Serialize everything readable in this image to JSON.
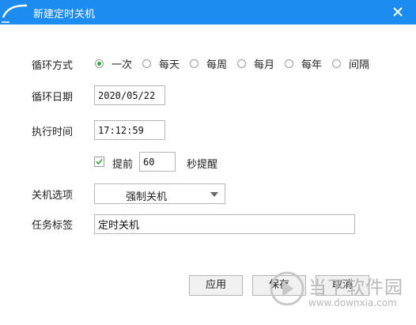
{
  "window": {
    "title": "新建定时关机"
  },
  "form": {
    "repeat_label": "循环方式",
    "repeat_options": [
      "一次",
      "每天",
      "每周",
      "每月",
      "每年",
      "间隔"
    ],
    "repeat_selected": "一次",
    "date_label": "循环日期",
    "date_value": "2020/05/22",
    "time_label": "执行时间",
    "time_value": "17:12:59",
    "remind_checked": true,
    "remind_label": "提前",
    "remind_value": "60",
    "remind_suffix": "秒提醒",
    "shutdown_label": "关机选项",
    "shutdown_value": "强制关机",
    "task_label": "任务标签",
    "task_value": "定时关机"
  },
  "buttons": {
    "apply": "应用",
    "save": "保存",
    "cancel": "取消"
  },
  "watermark": {
    "brand": "当下软件园",
    "url": "www.downxia.com"
  },
  "colors": {
    "titlebar": "#1c8cf0",
    "radio_checked": "#2da836",
    "check_mark": "#2da836"
  }
}
